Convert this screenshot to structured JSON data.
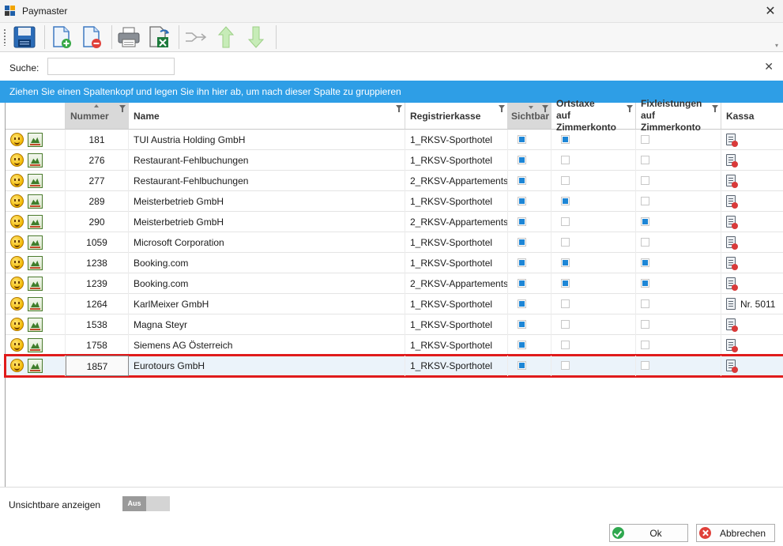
{
  "window": {
    "title": "Paymaster",
    "close_glyph": "✕"
  },
  "toolbar": {
    "buttons": [
      {
        "icon": "save-icon"
      },
      {
        "icon": "new-document-icon"
      },
      {
        "icon": "delete-document-icon"
      },
      {
        "icon": "print-icon"
      },
      {
        "icon": "excel-export-icon"
      },
      {
        "icon": "merge-icon"
      },
      {
        "icon": "arrow-up-icon"
      },
      {
        "icon": "arrow-down-icon"
      }
    ],
    "overflow_glyph": "▾"
  },
  "search": {
    "label": "Suche:",
    "value": "",
    "placeholder": "",
    "clear_glyph": "✕"
  },
  "group_panel": {
    "text": "Ziehen Sie einen Spaltenkopf und legen Sie ihn hier ab, um nach dieser Spalte zu gruppieren"
  },
  "columns": {
    "nummer": "Nummer",
    "name": "Name",
    "registrierkasse": "Registrierkasse",
    "sichtbar": "Sichtbar",
    "ortstaxe_1": "Ortstaxe",
    "ortstaxe_2": "auf Zimmerkonto",
    "fix_1": "Fixleistungen",
    "fix_2": "auf Zimmerkonto",
    "kassa": "Kassa"
  },
  "rows": [
    {
      "nummer": "181",
      "name": "TUI Austria Holding GmbH",
      "kasse": "1_RKSV-Sporthotel",
      "sichtbar": true,
      "ortstaxe": true,
      "fix": false,
      "kassa": ""
    },
    {
      "nummer": "276",
      "name": "Restaurant-Fehlbuchungen",
      "kasse": "1_RKSV-Sporthotel",
      "sichtbar": true,
      "ortstaxe": false,
      "fix": false,
      "kassa": ""
    },
    {
      "nummer": "277",
      "name": "Restaurant-Fehlbuchungen",
      "kasse": "2_RKSV-Appartements",
      "sichtbar": true,
      "ortstaxe": false,
      "fix": false,
      "kassa": ""
    },
    {
      "nummer": "289",
      "name": "Meisterbetrieb GmbH",
      "kasse": "1_RKSV-Sporthotel",
      "sichtbar": true,
      "ortstaxe": true,
      "fix": false,
      "kassa": ""
    },
    {
      "nummer": "290",
      "name": "Meisterbetrieb GmbH",
      "kasse": "2_RKSV-Appartements",
      "sichtbar": true,
      "ortstaxe": false,
      "fix": true,
      "kassa": ""
    },
    {
      "nummer": "1059",
      "name": "Microsoft Corporation",
      "kasse": "1_RKSV-Sporthotel",
      "sichtbar": true,
      "ortstaxe": false,
      "fix": false,
      "kassa": ""
    },
    {
      "nummer": "1238",
      "name": "Booking.com",
      "kasse": "1_RKSV-Sporthotel",
      "sichtbar": true,
      "ortstaxe": true,
      "fix": true,
      "kassa": ""
    },
    {
      "nummer": "1239",
      "name": "Booking.com",
      "kasse": "2_RKSV-Appartements",
      "sichtbar": true,
      "ortstaxe": true,
      "fix": true,
      "kassa": ""
    },
    {
      "nummer": "1264",
      "name": "KarlMeixer GmbH",
      "kasse": "1_RKSV-Sporthotel",
      "sichtbar": true,
      "ortstaxe": false,
      "fix": false,
      "kassa": "Nr. 5011"
    },
    {
      "nummer": "1538",
      "name": "Magna Steyr",
      "kasse": "1_RKSV-Sporthotel",
      "sichtbar": true,
      "ortstaxe": false,
      "fix": false,
      "kassa": ""
    },
    {
      "nummer": "1758",
      "name": "Siemens AG Österreich",
      "kasse": "1_RKSV-Sporthotel",
      "sichtbar": true,
      "ortstaxe": false,
      "fix": false,
      "kassa": ""
    },
    {
      "nummer": "1857",
      "name": "Eurotours GmbH",
      "kasse": "1_RKSV-Sporthotel",
      "sichtbar": true,
      "ortstaxe": false,
      "fix": false,
      "kassa": ""
    }
  ],
  "selected_row": 11,
  "footer": {
    "show_invisible_label": "Unsichtbare anzeigen",
    "toggle_text": "Aus",
    "ok_label": "Ok",
    "cancel_label": "Abbrechen"
  },
  "colors": {
    "accent": "#2e9ee6",
    "check": "#1d86d6",
    "selection_outline": "#e01b1b"
  }
}
